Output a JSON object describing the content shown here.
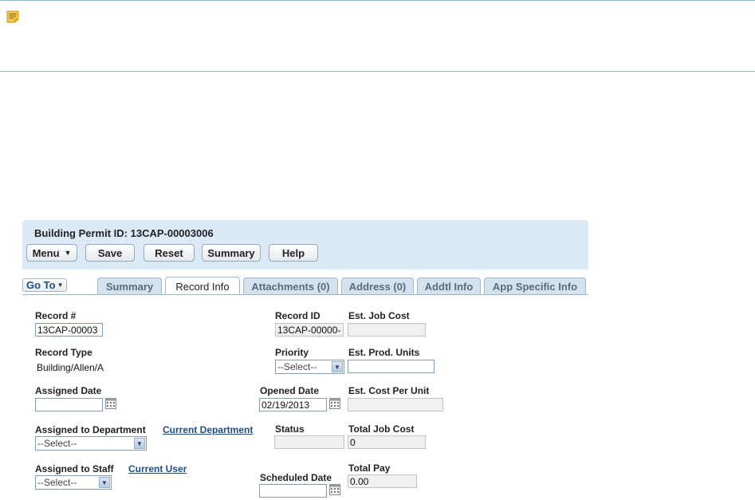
{
  "header": {
    "title": "Building Permit ID: 13CAP-00003006"
  },
  "toolbar": {
    "menu_label": "Menu",
    "save_label": "Save",
    "reset_label": "Reset",
    "summary_label": "Summary",
    "help_label": "Help"
  },
  "goto_label": "Go To",
  "tabs": [
    {
      "label": "Summary"
    },
    {
      "label": "Record Info",
      "active": true
    },
    {
      "label": "Attachments (0)"
    },
    {
      "label": "Address (0)"
    },
    {
      "label": "Addtl Info"
    },
    {
      "label": "App Specific Info"
    }
  ],
  "form": {
    "record_no": {
      "label": "Record #",
      "value": "13CAP-00003"
    },
    "record_id": {
      "label": "Record ID",
      "value": "13CAP-00000-"
    },
    "est_job_cost": {
      "label": "Est. Job Cost",
      "value": ""
    },
    "record_type": {
      "label": "Record Type",
      "value": "Building/Allen/A"
    },
    "priority": {
      "label": "Priority",
      "value": "--Select--"
    },
    "est_prod_units": {
      "label": "Est. Prod. Units",
      "value": ""
    },
    "assigned_date": {
      "label": "Assigned Date",
      "value": ""
    },
    "opened_date": {
      "label": "Opened Date",
      "value": "02/19/2013"
    },
    "est_cost_per_unit": {
      "label": "Est. Cost Per Unit",
      "value": ""
    },
    "assigned_dept": {
      "label": "Assigned to Department",
      "value": "--Select--",
      "link": "Current Department"
    },
    "status": {
      "label": "Status",
      "value": ""
    },
    "total_job_cost": {
      "label": "Total Job Cost",
      "value": "0"
    },
    "assigned_staff": {
      "label": "Assigned to Staff",
      "value": "--Select--",
      "link": "Current User"
    },
    "scheduled_date": {
      "label": "Scheduled Date",
      "value": ""
    },
    "total_pay": {
      "label": "Total Pay",
      "value": "0.00"
    }
  },
  "colors": {
    "panel_bg": "#dce9f7",
    "link": "#1c4e8a",
    "tab_bg": "#d4e1ef",
    "note_border": "#8fb9c2"
  },
  "icons": {
    "note": "note-icon",
    "calendar": "calendar-icon",
    "dropdown": "chevron-down-icon"
  }
}
